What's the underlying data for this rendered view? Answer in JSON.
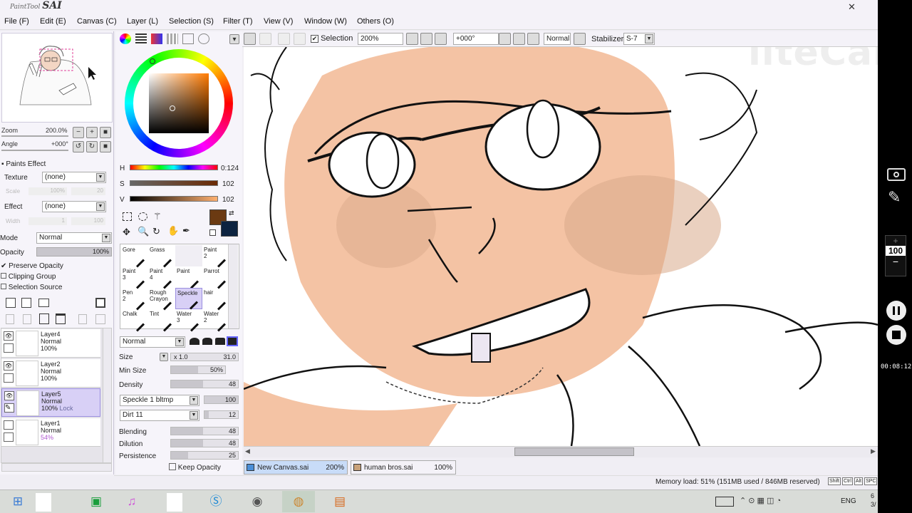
{
  "app": {
    "logo_small": "PaintTool",
    "logo_big": "SAI",
    "close": "✕"
  },
  "menu": [
    "File (F)",
    "Edit (E)",
    "Canvas (C)",
    "Layer (L)",
    "Selection (S)",
    "Filter (T)",
    "View (V)",
    "Window (W)",
    "Others (O)"
  ],
  "navigator": {
    "zoom_label": "Zoom",
    "zoom_value": "200.0%",
    "angle_label": "Angle",
    "angle_value": "+000°"
  },
  "paints_effect": {
    "header": "Paints Effect",
    "texture_label": "Texture",
    "texture_value": "(none)",
    "scale_label": "Scale",
    "scale_value": "100%",
    "scale_num": "20",
    "effect_label": "Effect",
    "effect_value": "(none)",
    "width_label": "Width",
    "width_value": "1",
    "width_num": "100"
  },
  "layer_props": {
    "mode_label": "Mode",
    "mode_value": "Normal",
    "opacity_label": "Opacity",
    "opacity_value": "100%",
    "preserve_opacity": "Preserve Opacity",
    "clipping_group": "Clipping Group",
    "selection_source": "Selection Source"
  },
  "layers": [
    {
      "name": "Layer4",
      "mode": "Normal",
      "opacity": "100%",
      "lock": "",
      "visible": true,
      "selected": false
    },
    {
      "name": "Layer2",
      "mode": "Normal",
      "opacity": "100%",
      "lock": "",
      "visible": true,
      "selected": false
    },
    {
      "name": "Layer5",
      "mode": "Normal",
      "opacity": "100%",
      "lock": "Lock",
      "visible": true,
      "selected": true
    },
    {
      "name": "Layer1",
      "mode": "Normal",
      "opacity": "54%",
      "lock": "",
      "visible": false,
      "selected": false
    }
  ],
  "color": {
    "h_label": "H",
    "h_value": "0:124",
    "s_label": "S",
    "s_value": "102",
    "v_label": "V",
    "v_value": "102",
    "primary": "#6b3a12",
    "secondary": "#0d2340"
  },
  "brushes": [
    {
      "name": "Gore"
    },
    {
      "name": "Grass"
    },
    {
      "name": ""
    },
    {
      "name": "Paint\n2"
    },
    {
      "name": "Paint\n3"
    },
    {
      "name": "Paint\n4"
    },
    {
      "name": "Paint"
    },
    {
      "name": "Parrot"
    },
    {
      "name": "Pen\n2"
    },
    {
      "name": "Rough\nCrayon"
    },
    {
      "name": "Speckle"
    },
    {
      "name": "hair"
    },
    {
      "name": "Chalk"
    },
    {
      "name": "Tint"
    },
    {
      "name": "Water\n3"
    },
    {
      "name": "Water\n2"
    }
  ],
  "brush_params": {
    "blend_mode": "Normal",
    "size_label": "Size",
    "size_mult": "x 1.0",
    "size_value": "31.0",
    "min_size_label": "Min Size",
    "min_size_value": "50%",
    "density_label": "Density",
    "density_value": "48",
    "shape_value": "Speckle 1 bltmp",
    "shape_num": "100",
    "texture_value": "Dirt 11",
    "texture_num": "12",
    "blending_label": "Blending",
    "blending_value": "48",
    "dilution_label": "Dilution",
    "dilution_value": "48",
    "persistence_label": "Persistence",
    "persistence_value": "25",
    "keep_opacity": "Keep Opacity"
  },
  "toolbar": {
    "selection_label": "Selection",
    "zoom_value": "200%",
    "angle_value": "+000°",
    "blend_value": "Normal",
    "stabilizer_label": "Stabilizer",
    "stabilizer_value": "S-7"
  },
  "watermark": "liteCam",
  "documents": [
    {
      "name": "New Canvas.sai",
      "zoom": "200%",
      "active": true
    },
    {
      "name": "human bros.sai",
      "zoom": "100%",
      "active": false
    }
  ],
  "status": {
    "memory": "Memory load: 51% (151MB used / 846MB reserved)",
    "keys": [
      "Shift",
      "Ctrl",
      "Alt",
      "SPC"
    ]
  },
  "recorder": {
    "zoom_value": "100",
    "plus": "+",
    "minus": "−",
    "timer": "00:08:12"
  },
  "taskbar": {
    "lang": "ENG",
    "clock_line1": "6",
    "clock_line2": "3/"
  }
}
